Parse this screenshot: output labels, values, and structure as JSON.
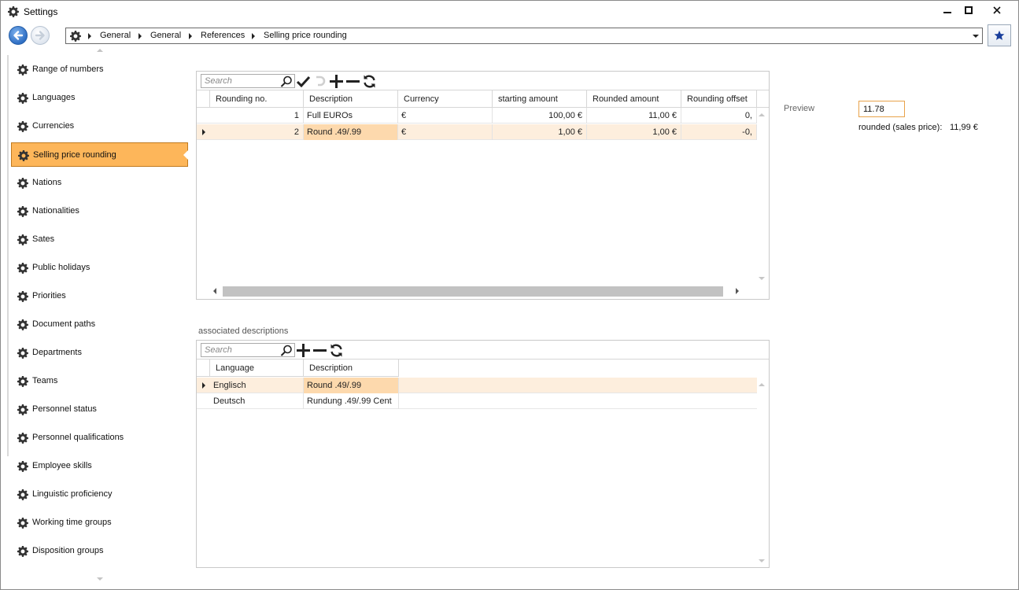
{
  "window": {
    "title": "Settings",
    "icon": "gear-icon"
  },
  "breadcrumb": {
    "items": [
      "General",
      "General",
      "References",
      "Selling price rounding"
    ]
  },
  "sidebar": {
    "items": [
      {
        "label": "Range of numbers"
      },
      {
        "label": "Languages"
      },
      {
        "label": "Currencies"
      },
      {
        "label": "Selling price rounding",
        "selected": true
      },
      {
        "label": "Nations"
      },
      {
        "label": "Nationalities"
      },
      {
        "label": "Sates"
      },
      {
        "label": "Public holidays"
      },
      {
        "label": "Priorities"
      },
      {
        "label": "Document paths"
      },
      {
        "label": "Departments"
      },
      {
        "label": "Teams"
      },
      {
        "label": "Personnel status"
      },
      {
        "label": "Personnel qualifications"
      },
      {
        "label": "Employee skills"
      },
      {
        "label": "Linguistic proficiency"
      },
      {
        "label": "Working time groups"
      },
      {
        "label": "Disposition groups"
      }
    ]
  },
  "rounding_grid": {
    "search_placeholder": "Search",
    "columns": [
      "Rounding no.",
      "Description",
      "Currency",
      "starting amount",
      "Rounded amount",
      "Rounding offset"
    ],
    "rows": [
      {
        "no": "1",
        "description": "Full EUROs",
        "currency": "€",
        "starting": "100,00 €",
        "rounded": "11,00 €",
        "offset": "0,",
        "selected": false
      },
      {
        "no": "2",
        "description": "Round .49/.99",
        "currency": "€",
        "starting": "1,00 €",
        "rounded": "1,00 €",
        "offset": "-0,",
        "selected": true
      }
    ]
  },
  "descriptions_section": {
    "label": "associated descriptions",
    "search_placeholder": "Search",
    "columns": [
      "Language",
      "Description"
    ],
    "rows": [
      {
        "language": "Englisch",
        "description": "Round .49/.99",
        "selected": true
      },
      {
        "language": "Deutsch",
        "description": "Rundung .49/.99 Cent",
        "selected": false
      }
    ]
  },
  "preview": {
    "label": "Preview",
    "input_value": "11.78",
    "rounded_label": "rounded (sales price):",
    "rounded_value": "11,99 €"
  },
  "colors": {
    "selected_nav": "#fdb65a",
    "selected_row": "#fdeedd",
    "highlight_cell": "#fdd9ad",
    "back_button": "#2f6fc4",
    "favorite_star": "#1a3f9c"
  }
}
